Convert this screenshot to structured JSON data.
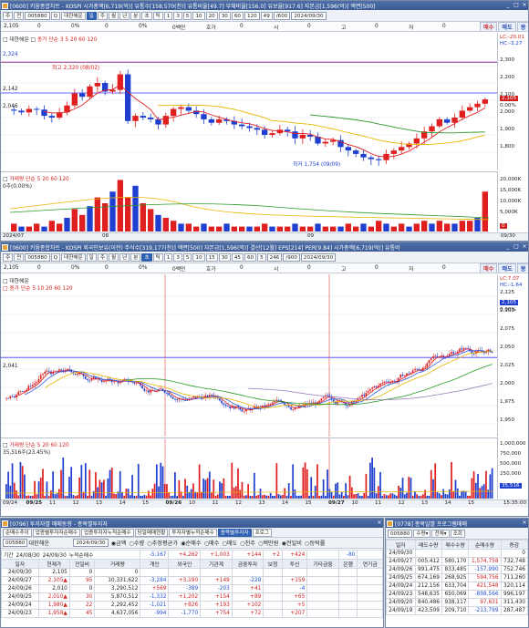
{
  "colors": {
    "up": "#e02020",
    "down": "#1f3fd0",
    "ma5": "#e02020",
    "ma20": "#e8b400",
    "ma60": "#2a9a2a",
    "ma120": "#9a7fc0",
    "accent": "#3a5a96"
  },
  "w1": {
    "title": "[0600] 키움종합차트 - KOSPI 시가총액[6,719(억)] 유통수[158,570(천)] 유통비율[49.7] 부채비율[156.0] 유보율[917.6] 자본금[1,596(억)] 액면[500]",
    "toolbar": [
      "주",
      "전",
      "005880",
      "Q",
      "대한해운",
      "일",
      "주",
      "월",
      "년",
      "분",
      "초",
      "틱",
      "1",
      "3",
      "5",
      "10",
      "20",
      "30",
      "60",
      "120",
      "49",
      "/600",
      "2024/09/30"
    ],
    "quote": [
      "2,105",
      "0",
      "0%",
      "0",
      "0%",
      "0백만",
      "호가",
      "0",
      "시",
      "0",
      "고",
      "0",
      "저",
      "0"
    ],
    "bid": "매수",
    "ask": "매도",
    "ext": "몽",
    "legend_price": "대한해운",
    "legend_ma": "종가 단순 3 5 20 60 120",
    "ind_lc": "LC:-20.01",
    "ind_hc": "HC:-3.27",
    "y_labels": [
      "2,300",
      "2,200",
      "2,100",
      "2,000",
      "1,900",
      "1,800"
    ],
    "marks": {
      "max": "최고 2,320 (08/02)",
      "min": "최저 1,754 (09/09)",
      "left_hi": "2,324",
      "left_mid": "2,142",
      "left_lo": "2,046",
      "cur": "2,105",
      "cur_pct": "0.00%"
    },
    "vol_legend": "거래량 단순 5 20 60 120",
    "vol_axis": [
      "20,000K",
      "15,000K",
      "10,000K",
      "5,000K"
    ],
    "vol_sub": "0주(0.00%)",
    "vol_last": "0",
    "xdates": [
      "2024/07",
      "08",
      "09"
    ],
    "xright": "09/30"
  },
  "w2": {
    "title": "[0600] 키움종합차트 - KOSPI 외국인보유(이전) 주식수[319,177(천)] 액면[500] 자본금[1,596(억)] 결산[12월] EPS[214] PER[9.84] 시가총액[6,719(억)] 유통비",
    "toolbar": [
      "주",
      "전",
      "005880",
      "Q",
      "대한해운",
      "일",
      "주",
      "월",
      "년",
      "분",
      "초",
      "틱",
      "1",
      "3",
      "5",
      "10",
      "15",
      "30",
      "45",
      "60",
      "5",
      "246",
      "/900",
      "2024/09/30"
    ],
    "quote": [
      "2,105",
      "0",
      "0%",
      "0",
      "0%",
      "0백만",
      "호가",
      "0",
      "시",
      "0",
      "고",
      "0",
      "저",
      "0"
    ],
    "bid": "매수",
    "ask": "매도",
    "ext": "몽",
    "legend_price": "대한해운",
    "legend_ma": "종가 단순 5 10 20 60 120",
    "ind_lc": "LC:7.07",
    "ind_hc": "HC:-1.64",
    "y_labels": [
      "2,125",
      "2,100",
      "2,075",
      "2,050",
      "2,025",
      "2,000",
      "1,975",
      "1,950"
    ],
    "marks": {
      "left": "2,041",
      "cur": "2,105",
      "cur_pct": "0.00%"
    },
    "vol_legend": "거래량 단순 5 20 60 120",
    "vol_sub": "35,516주(23.45%)",
    "vol_axis": [
      "1,000,000",
      "750,000",
      "500,000",
      "250,000"
    ],
    "vol_last": "35,516",
    "xdates": [
      "09/24",
      "09/25",
      "11",
      "12",
      "13",
      "14",
      "15",
      "09/26",
      "10",
      "11",
      "12",
      "13",
      "14",
      "15",
      "09/27",
      "10",
      "11",
      "12",
      "13",
      "14",
      "15"
    ],
    "xright": "15:35:00"
  },
  "w3": {
    "title": "[0796] 투자자별 매매동향 - 종목별투자자",
    "tabs": [
      "순매수추이",
      "업종별투자자순매수",
      "업종투자자누적순매수",
      "당일매매현황",
      "투자자별누적순매수",
      "종목별투자자",
      "프로그"
    ],
    "controls": {
      "code": "005880",
      "name": "대한해운",
      "date": "2024/09/30",
      "opts": [
        "금액",
        "수량",
        "추정평균가",
        "순매수",
        "매수",
        "매도",
        "천주",
        "백만원",
        "전일비",
        "등락률"
      ]
    },
    "period": {
      "label": "기간",
      "from": "24/08/30",
      "to": "24/09/30",
      "cum": "누적순매수",
      "vals": [
        "-5,167",
        "+4,262",
        "+1,003",
        "+144",
        "+2",
        "+424",
        "",
        "-80"
      ]
    },
    "headers": [
      "일자",
      "현재가",
      "전일비",
      "거래량",
      "개인",
      "외국인",
      "기관계",
      "금융투자",
      "보험",
      "투신",
      "기타금융",
      "은행",
      "연기금"
    ],
    "rows": [
      [
        "24/09/30",
        "2,105",
        "0",
        "0",
        "",
        "",
        "",
        "",
        "",
        "",
        "",
        "",
        ""
      ],
      [
        "24/09/27",
        "2,105▲",
        "95",
        "10,331,622",
        "-3,284",
        "+3,190",
        "+149",
        "-228",
        "",
        "+159",
        "",
        "",
        ""
      ],
      [
        "24/09/26",
        "2,010",
        "0",
        "3,290,512",
        "+569",
        "-389",
        "-203",
        "+41",
        "",
        "-4",
        "",
        "",
        ""
      ],
      [
        "24/09/25",
        "2,010▲",
        "30",
        "5,870,512",
        "-1,332",
        "+1,202",
        "+154",
        "+89",
        "",
        "+65",
        "",
        "",
        ""
      ],
      [
        "24/09/24",
        "1,980▲",
        "22",
        "2,292,452",
        "-1,021",
        "+826",
        "+193",
        "+102",
        "",
        "+5",
        "",
        "",
        ""
      ],
      [
        "24/09/23",
        "1,958▲",
        "45",
        "4,637,056",
        "-994",
        "-1,770",
        "+754",
        "+72",
        "",
        "+207",
        "",
        "",
        ""
      ]
    ]
  },
  "w4": {
    "title": "[0778] 종목일별 프로그램매매",
    "controls": {
      "code": "005880",
      "opt1": "수량",
      "opt2": "전체",
      "query": "조회"
    },
    "headers": [
      "일자",
      "매도수량",
      "매수수량",
      "순매수량",
      "증감"
    ],
    "rows": [
      [
        "24/09/30",
        "",
        "",
        "",
        "0"
      ],
      [
        "24/09/27",
        "005,412",
        "580,170",
        "1,574,758",
        "732,748"
      ],
      [
        "24/09/26",
        "991,475",
        "833,485",
        "-157,990",
        "752,746"
      ],
      [
        "24/09/25",
        "674,169",
        "268,925",
        "594,756",
        "711,260"
      ],
      [
        "24/09/24",
        "212,156",
        "633,704",
        "421,548",
        "320,114"
      ],
      [
        "24/09/23",
        "548,635",
        "650,069",
        "-898,566",
        "996,197"
      ],
      [
        "24/09/20",
        "840,486",
        "938,117",
        "97,631",
        "311,430"
      ],
      [
        "24/09/19",
        "423,509",
        "209,710",
        "-213,799",
        "287,487"
      ]
    ]
  }
}
